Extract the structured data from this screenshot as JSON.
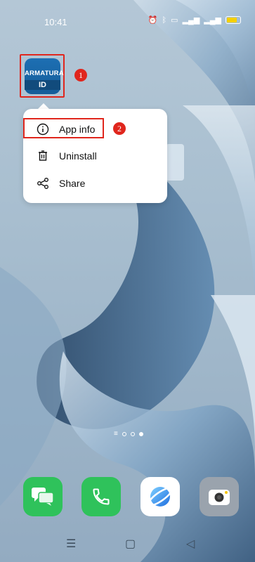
{
  "status_bar": {
    "time": "10:41",
    "battery_level": 0.72,
    "icons": [
      "alarm-icon",
      "bluetooth-icon",
      "volte-icon",
      "signal-icon",
      "signal-icon",
      "battery-icon"
    ]
  },
  "app": {
    "name_line1": "ARMATURA",
    "name_line2": "ID"
  },
  "annotations": {
    "step1": "1",
    "step2": "2",
    "highlight_color": "#e0261d"
  },
  "context_menu": {
    "items": [
      {
        "label": "App info",
        "icon": "info-icon"
      },
      {
        "label": "Uninstall",
        "icon": "trash-icon"
      },
      {
        "label": "Share",
        "icon": "share-icon"
      }
    ]
  },
  "dock": {
    "apps": [
      "messages-icon",
      "phone-icon",
      "browser-icon",
      "camera-icon"
    ]
  },
  "page_indicator": {
    "pages": 3,
    "active": 3
  }
}
